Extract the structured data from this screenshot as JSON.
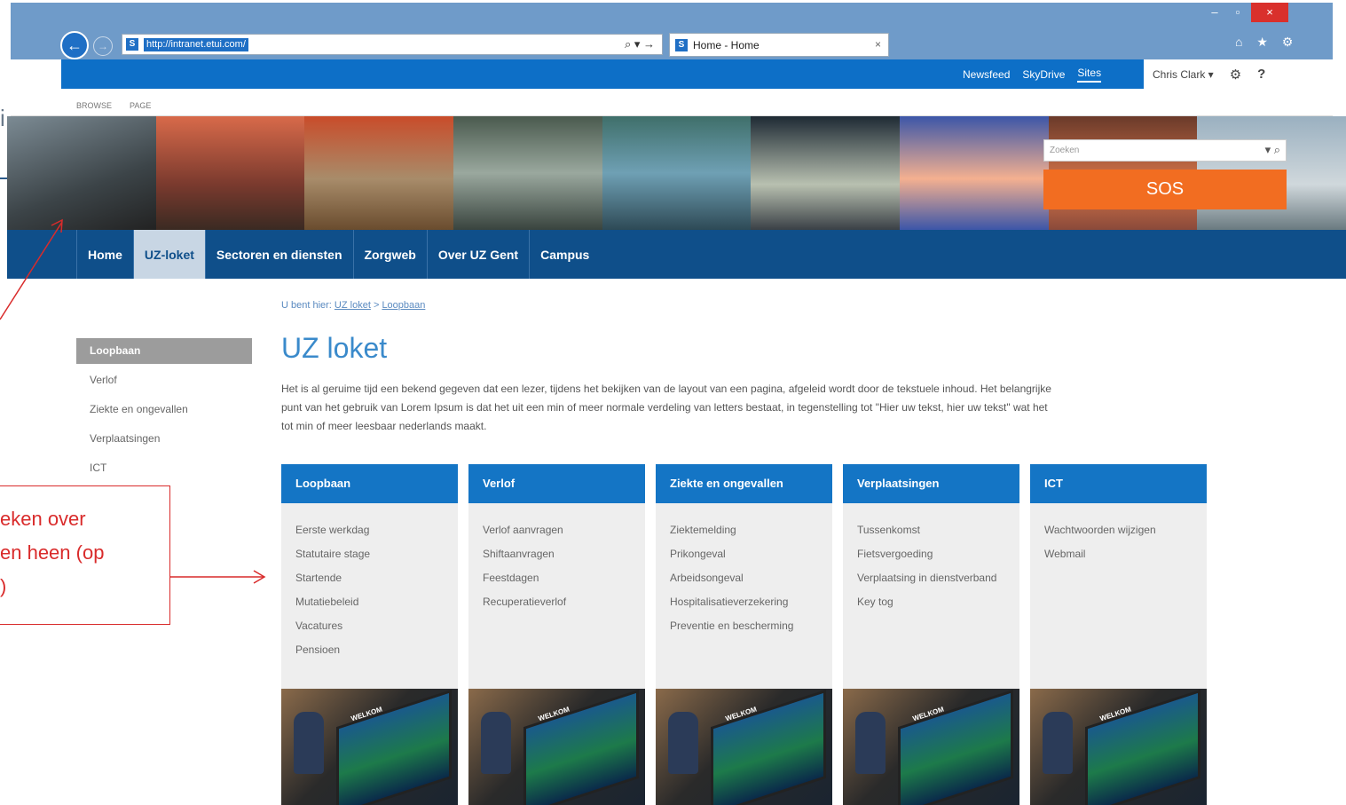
{
  "browser": {
    "url": "http://intranet.etui.com/",
    "tab_title": "Home - Home",
    "tab_close": "×",
    "addr_tools": "⌕ ▾ →",
    "win_min": "–",
    "win_max": "▫",
    "win_close": "×",
    "ie_icons": "⌂ ★ ⚙"
  },
  "suitebar": {
    "links": [
      "Newsfeed",
      "SkyDrive",
      "Sites"
    ],
    "user": "Chris Clark ▾",
    "gear": "⚙",
    "help": "?"
  },
  "ribbon": {
    "browse": "BROWSE",
    "page": "PAGE"
  },
  "search": {
    "placeholder": "Zoeken",
    "tools": "▾ ⌕"
  },
  "sos": {
    "label": "SOS",
    "color": "#f26d21"
  },
  "topnav": {
    "items": [
      "Home",
      "UZ-loket",
      "Sectoren en diensten",
      "Zorgweb",
      "Over UZ Gent",
      "Campus"
    ],
    "active": "UZ-loket"
  },
  "breadcrumb": {
    "prefix": "U bent hier: ",
    "crumb1": "UZ loket",
    "sep": " > ",
    "crumb2": "Loopbaan"
  },
  "leftnav": {
    "items": [
      "Loopbaan",
      "Verlof",
      "Ziekte en ongevallen",
      "Verplaatsingen",
      "ICT"
    ],
    "active": "Loopbaan"
  },
  "main": {
    "title": "UZ loket",
    "intro": "Het is al geruime tijd een bekend gegeven dat een lezer, tijdens het bekijken van de layout van een pagina, afgeleid wordt door de tekstuele inhoud. Het belangrijke punt van het gebruik van Lorem Ipsum is dat het uit een min of meer normale verdeling van letters bestaat, in tegenstelling tot \"Hier uw tekst, hier uw tekst\" wat het tot min of meer leesbaar nederlands maakt."
  },
  "cards": [
    {
      "title": "Loopbaan",
      "links": [
        "Eerste werkdag",
        "Statutaire stage",
        "Startende",
        "Mutatiebeleid",
        "Vacatures",
        "Pensioen"
      ]
    },
    {
      "title": "Verlof",
      "links": [
        "Verlof aanvragen",
        "Shiftaanvragen",
        "Feestdagen",
        "Recuperatieverlof"
      ]
    },
    {
      "title": "Ziekte en ongevallen",
      "links": [
        "Ziektemelding",
        "Prikongeval",
        "Arbeidsongeval",
        "Hospitalisatieverzekering",
        "Preventie en bescherming"
      ]
    },
    {
      "title": "Verplaatsingen",
      "links": [
        "Tussenkomst",
        "Fietsvergoeding",
        "Verplaatsing in dienstverband",
        "Key tog"
      ]
    },
    {
      "title": "ICT",
      "links": [
        "Wachtwoorden wijzigen",
        "Webmail"
      ]
    }
  ],
  "card_image_text": "WELKOM",
  "annotation": {
    "text": "eken over\nen heen (op\n)",
    "color": "#d92b2b"
  }
}
